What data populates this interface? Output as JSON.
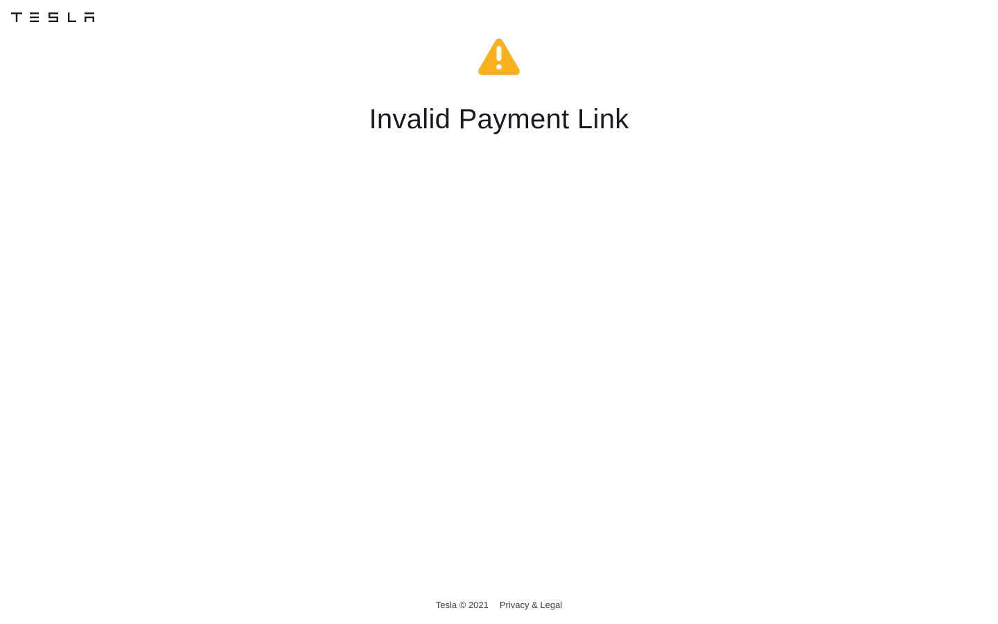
{
  "header": {
    "logo_text": "TESLA",
    "logo_icon": "tesla-wordmark"
  },
  "main": {
    "icon": "warning-icon",
    "icon_color": "#fbb11e",
    "title": "Invalid Payment Link"
  },
  "footer": {
    "copyright": "Tesla © 2021",
    "privacy_link": "Privacy & Legal"
  },
  "colors": {
    "text": "#171a20",
    "footer_text": "#393c41",
    "background": "#ffffff"
  }
}
